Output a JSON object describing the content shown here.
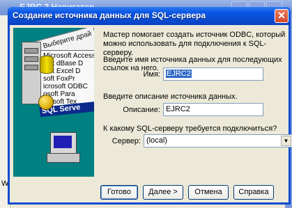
{
  "background_window": {
    "title": "EJRC 2 Навигатор",
    "side_text": "Wi"
  },
  "dialog": {
    "title": "Создание источника данных для SQL-сервера",
    "close_glyph": "✕",
    "intro": "Мастер помогает создать источник ODBC, который можно использовать для подключения к SQL-серверу.",
    "name_prompt": "Введите имя источника данных для последующих ссылок на него.",
    "name_label": "Имя:",
    "name_value": "EJRC2",
    "desc_prompt": "Введите описание источника данных.",
    "desc_label": "Описание:",
    "desc_value": "EJRC2",
    "server_prompt": "К какому SQL-серверу требуется подключиться?",
    "server_label": "Сервер:",
    "server_value": "(local)",
    "dropdown_glyph": "▼"
  },
  "illustration": {
    "card_header": "Выберите драй",
    "driver_list": [
      "Microsoft Access I",
      "soft dBase D",
      "soft Excel D",
      "soft FoxPr",
      "icrosoft ODBC",
      "osoft Para",
      "crosoft Tex"
    ],
    "sql_label": "SQL Serve"
  },
  "buttons": {
    "finish": "Готово",
    "next": "Далее >",
    "cancel": "Отмена",
    "help": "Справка"
  },
  "colors": {
    "titlebar": "#0a4bd0",
    "dialog_bg": "#ece9d8",
    "illustration_bg": "#008080",
    "selection": "#316ac5"
  }
}
